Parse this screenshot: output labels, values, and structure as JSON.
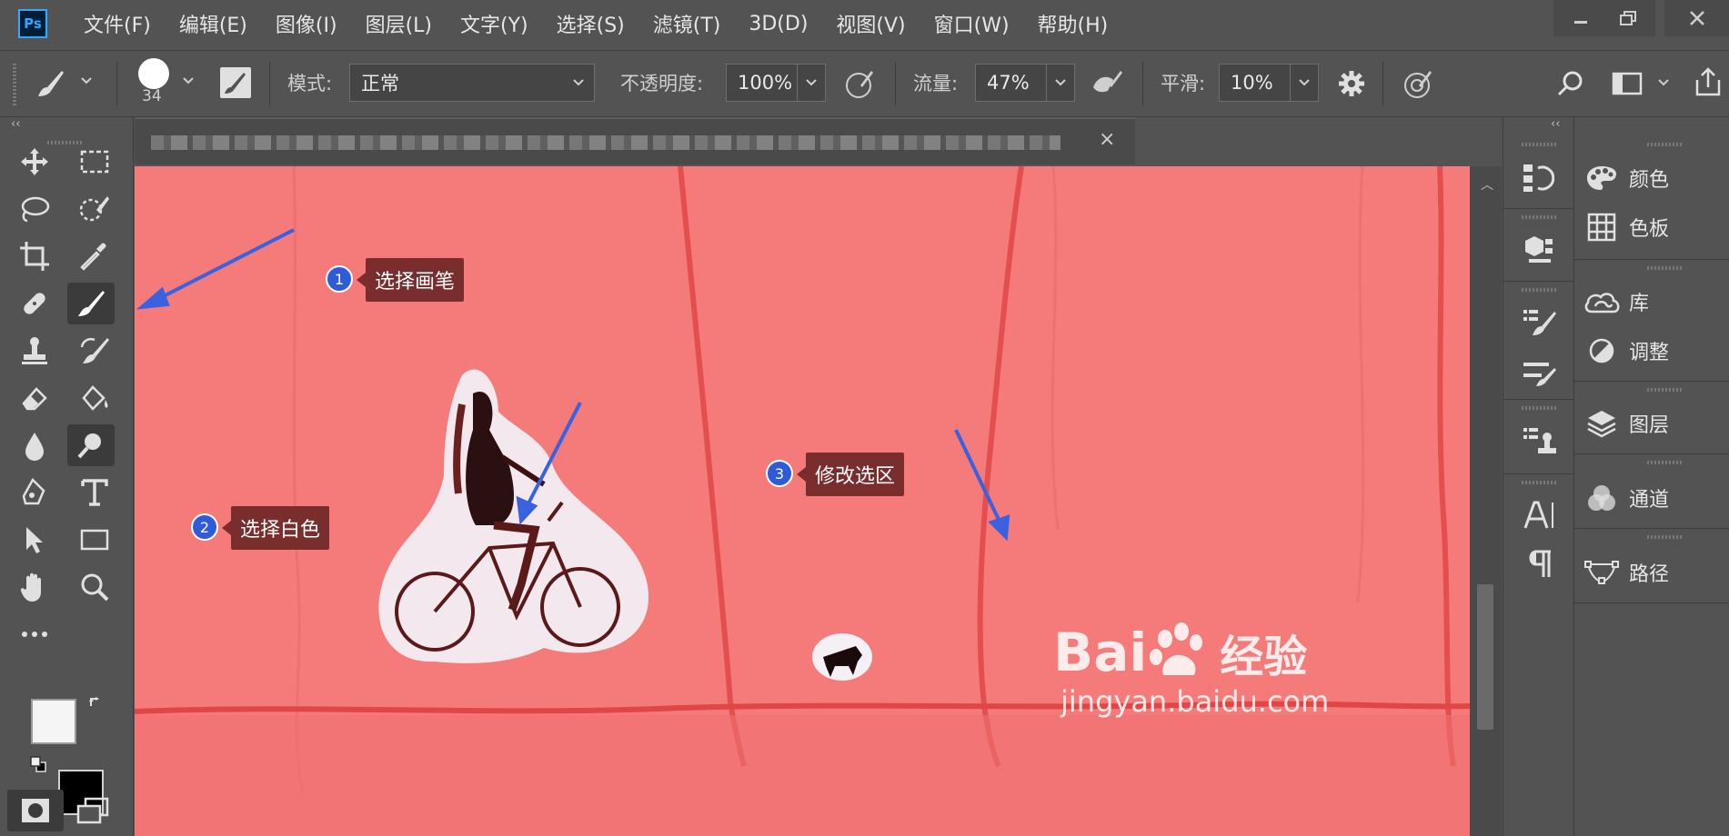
{
  "app": {
    "logo_text": "Ps"
  },
  "menu": [
    "文件(F)",
    "编辑(E)",
    "图像(I)",
    "图层(L)",
    "文字(Y)",
    "选择(S)",
    "滤镜(T)",
    "3D(D)",
    "视图(V)",
    "窗口(W)",
    "帮助(H)"
  ],
  "options": {
    "brush_size": "34",
    "mode_label": "模式:",
    "mode_value": "正常",
    "opacity_label": "不透明度:",
    "opacity_value": "100%",
    "flow_label": "流量:",
    "flow_value": "47%",
    "smoothing_label": "平滑:",
    "smoothing_value": "10%"
  },
  "panels": [
    {
      "label": "颜色",
      "icon": "palette-icon"
    },
    {
      "label": "色板",
      "icon": "swatches-grid-icon"
    },
    {
      "label": "库",
      "icon": "cloud-libraries-icon"
    },
    {
      "label": "调整",
      "icon": "adjustments-icon"
    },
    {
      "label": "图层",
      "icon": "layers-icon"
    },
    {
      "label": "通道",
      "icon": "channels-icon"
    },
    {
      "label": "路径",
      "icon": "paths-icon"
    }
  ],
  "annotations": [
    {
      "number": "1",
      "text": "选择画笔"
    },
    {
      "number": "2",
      "text": "选择白色"
    },
    {
      "number": "3",
      "text": "修改选区"
    }
  ],
  "watermark": {
    "brand": "Bai",
    "brand_cn": "经验",
    "url": "jingyan.baidu.com"
  },
  "colors": {
    "foreground": "#f5f5f5",
    "background": "#000000",
    "canvas": "#f57a7a",
    "callout": "#7a2d2d",
    "badge": "#2f5bd9",
    "arrow": "#3a62e0"
  }
}
